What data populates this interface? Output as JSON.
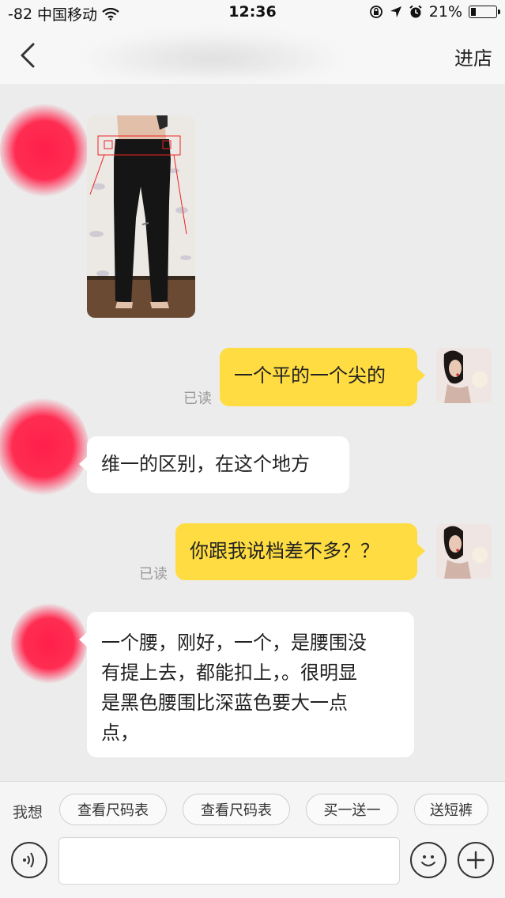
{
  "status_bar": {
    "signal": "-82",
    "carrier": "中国移动",
    "time": "12:36",
    "battery_percent": "21%",
    "battery_level": 0.21
  },
  "nav": {
    "enter_shop_label": "进店"
  },
  "messages": [
    {
      "type": "image",
      "side": "in"
    },
    {
      "side": "out",
      "text": "一个平的一个尖的",
      "read": "已读"
    },
    {
      "side": "in",
      "text": "维一的区别，在这个地方"
    },
    {
      "side": "out",
      "text": "你跟我说档差不多？？",
      "read": "已读"
    },
    {
      "side": "in",
      "lines": [
        "一个腰，刚好，一个，是腰围没",
        "有提上去，都能扣上，。很明显",
        "是黑色腰围比深蓝色要大一点",
        "点，"
      ]
    }
  ],
  "quick_replies": {
    "prefix": "我想",
    "chips": [
      "查看尺码表",
      "查看尺码表",
      "买一送一",
      "送短裤"
    ]
  },
  "colors": {
    "outgoing_bubble": "#ffdc41",
    "incoming_bubble": "#ffffff",
    "background": "#ececec",
    "scribble": "#ff1f4b"
  },
  "icons": [
    "back-chevron-icon",
    "wifi-icon",
    "lock-rotation-icon",
    "location-arrow-icon",
    "alarm-icon",
    "battery-icon",
    "voice-icon",
    "emoji-icon",
    "plus-icon"
  ]
}
